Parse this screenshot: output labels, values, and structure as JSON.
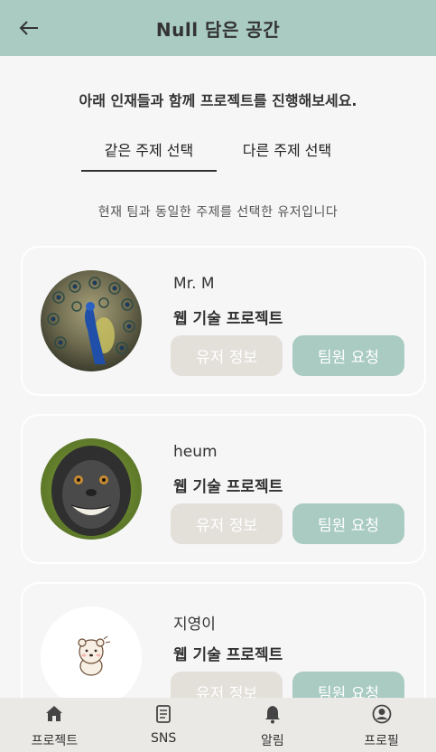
{
  "header": {
    "title": "Null 담은 공간",
    "back_icon": "arrow-left-icon"
  },
  "intro": "아래 인재들과 함께 프로젝트를 진행해보세요.",
  "tabs": [
    {
      "label": "같은 주제 선택",
      "active": true
    },
    {
      "label": "다른 주제 선택",
      "active": false
    }
  ],
  "description": "현재 팀과 동일한 주제를 선택한 유저입니다",
  "users": [
    {
      "name": "Mr. M",
      "project": "웹 기술 프로젝트",
      "info_label": "유저 정보",
      "request_label": "팀원 요청",
      "avatar": "peacock-photo"
    },
    {
      "name": "heum",
      "project": "웹 기술 프로젝트",
      "info_label": "유저 정보",
      "request_label": "팀원 요청",
      "avatar": "monkey-photo"
    },
    {
      "name": "지영이",
      "project": "웹 기술 프로젝트",
      "info_label": "유저 정보",
      "request_label": "팀원 요청",
      "avatar": "bear-illustration"
    }
  ],
  "nav": [
    {
      "label": "프로젝트",
      "icon": "home-icon"
    },
    {
      "label": "SNS",
      "icon": "document-icon"
    },
    {
      "label": "알림",
      "icon": "bell-icon"
    },
    {
      "label": "프로필",
      "icon": "user-circle-icon"
    }
  ],
  "colors": {
    "accent": "#a9cbc2",
    "info_button": "#e3e0da",
    "background": "#f6f6f6",
    "nav_background": "#ebe9e6"
  }
}
